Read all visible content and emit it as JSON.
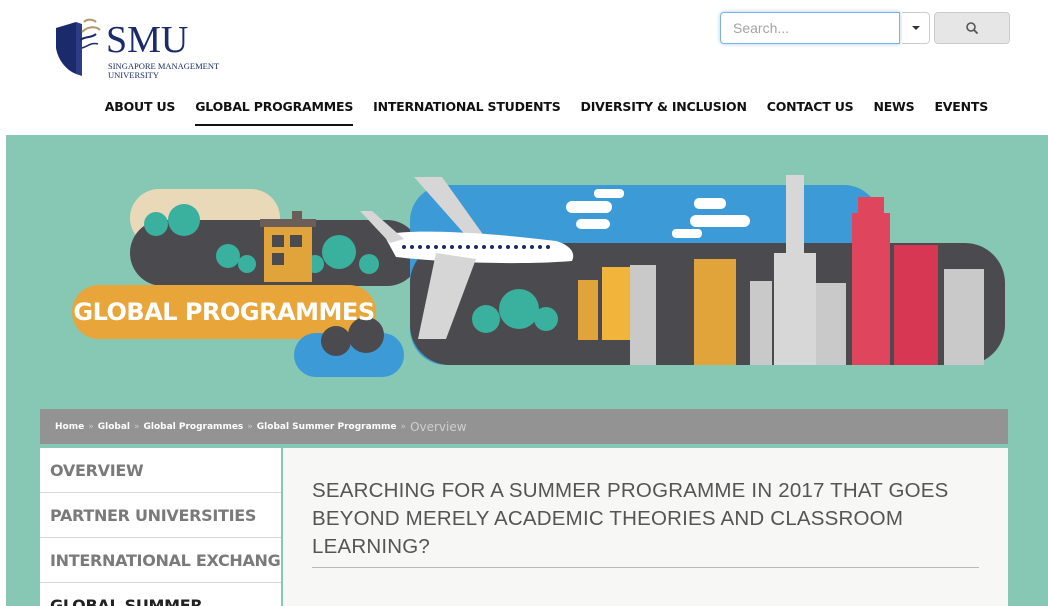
{
  "header": {
    "logo_text": "SMU",
    "logo_subtitle": "SINGAPORE MANAGEMENT UNIVERSITY",
    "search_placeholder": "Search..."
  },
  "nav": {
    "items": [
      {
        "label": "ABOUT US",
        "active": false
      },
      {
        "label": "GLOBAL PROGRAMMES",
        "active": true
      },
      {
        "label": "INTERNATIONAL STUDENTS",
        "active": false
      },
      {
        "label": "DIVERSITY & INCLUSION",
        "active": false
      },
      {
        "label": "CONTACT US",
        "active": false
      },
      {
        "label": "NEWS",
        "active": false
      },
      {
        "label": "EVENTS",
        "active": false
      }
    ]
  },
  "banner": {
    "title": "GLOBAL PROGRAMMES"
  },
  "breadcrumb": {
    "home": "Home",
    "global": "Global",
    "global_programmes": "Global Programmes",
    "global_summer_programme": "Global Summer Programme",
    "current": "Overview",
    "separator": "»"
  },
  "sidebar": {
    "overview": "OVERVIEW",
    "partner_universities": "PARTNER UNIVERSITIES",
    "international_exchange": "INTERNATIONAL EXCHANGE",
    "global_summer": "GLOBAL SUMMER"
  },
  "content": {
    "heading": "SEARCHING FOR A SUMMER PROGRAMME IN 2017 THAT GOES BEYOND MERELY ACADEMIC THEORIES AND CLASSROOM LEARNING?"
  },
  "colors": {
    "brand_navy": "#1b2a6b",
    "banner_teal": "#86c8b4",
    "breadcrumb_gray": "#939393",
    "banner_title_orange": "#e8a53a"
  }
}
